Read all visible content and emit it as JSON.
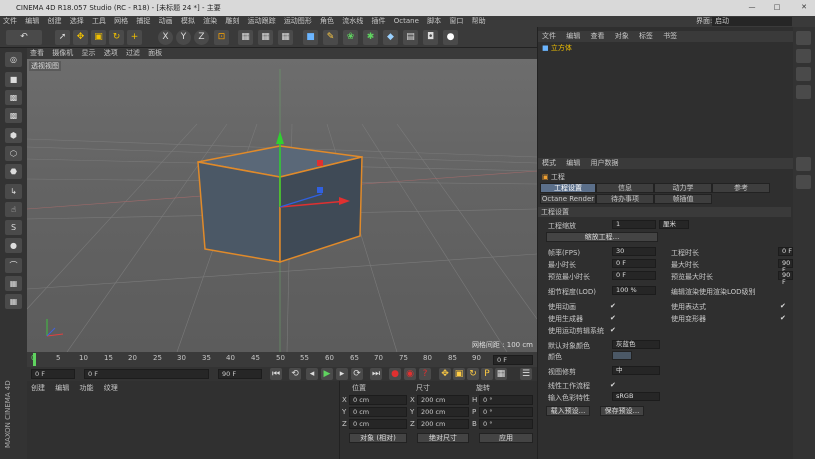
{
  "window": {
    "title": "CINEMA 4D R18.057 Studio (RC - R18) - [未标题 24 *] - 主要"
  },
  "menu": [
    "文件",
    "编辑",
    "创建",
    "选择",
    "工具",
    "网格",
    "捕捉",
    "动画",
    "模拟",
    "渲染",
    "雕刻",
    "运动跟踪",
    "运动图形",
    "角色",
    "流水线",
    "插件",
    "Octane",
    "脚本",
    "窗口",
    "帮助"
  ],
  "layout": {
    "label": "界面:",
    "value": "启动"
  },
  "toolbar": {
    "x": "X",
    "y": "Y",
    "z": "Z"
  },
  "viewport": {
    "menu": [
      "查看",
      "摄像机",
      "显示",
      "选项",
      "过滤",
      "面板"
    ],
    "tag": "透视视图",
    "grid": "网格间距 : 100 cm"
  },
  "timeline": {
    "ticks": [
      "0",
      "5",
      "10",
      "15",
      "20",
      "25",
      "30",
      "35",
      "40",
      "45",
      "50",
      "55",
      "60",
      "65",
      "70",
      "75",
      "80",
      "85",
      "90"
    ],
    "frame": "0 F"
  },
  "transport": {
    "start": "0 F",
    "cur": "0 F",
    "end": "90 F",
    "end2": "90 F"
  },
  "materials": {
    "menu": [
      "创建",
      "编辑",
      "功能",
      "纹理"
    ]
  },
  "coords": {
    "headers": [
      "位置",
      "尺寸",
      "旋转"
    ],
    "rows": [
      {
        "axis": "X",
        "pos": "0 cm",
        "sizeAxis": "X",
        "size": "200 cm",
        "rotAxis": "H",
        "rot": "0 °"
      },
      {
        "axis": "Y",
        "pos": "0 cm",
        "sizeAxis": "Y",
        "size": "200 cm",
        "rotAxis": "P",
        "rot": "0 °"
      },
      {
        "axis": "Z",
        "pos": "0 cm",
        "sizeAxis": "Z",
        "size": "200 cm",
        "rotAxis": "B",
        "rot": "0 °"
      }
    ],
    "mode": "对象 (相对)",
    "sizeMode": "绝对尺寸",
    "apply": "应用"
  },
  "objects": {
    "menu": [
      "文件",
      "编辑",
      "查看",
      "对象",
      "标签",
      "书签"
    ],
    "item": "立方体"
  },
  "attributes": {
    "menu": [
      "模式",
      "编辑",
      "用户数据"
    ],
    "title": "工程",
    "tabs": [
      "工程设置",
      "信息",
      "动力学",
      "参考"
    ],
    "tabs2": [
      "Octane Render",
      "待办事项",
      "帧插值"
    ],
    "section": "工程设置",
    "scaleLabel": "工程缩放",
    "scaleVal": "1",
    "scaleUnit": "厘米",
    "scaleBtn": "缩放工程...",
    "fpsLabel": "帧率(FPS)",
    "fps": "30",
    "projLenLabel": "工程时长",
    "projLen": "0 F",
    "minLabel": "最小时长",
    "min": "0 F",
    "maxLabel": "最大时长",
    "max": "90 F",
    "pminLabel": "预览最小时长",
    "pmin": "0 F",
    "pmaxLabel": "预览最大时长",
    "pmax": "90 F",
    "lodLabel": "细节程度(LOD)",
    "lod": "100 %",
    "lodEdit": "编辑渲染使用渲染LOD级别",
    "checks": [
      "使用动画",
      "使用表达式",
      "使用生成器",
      "使用变形器",
      "使用运动剪辑系统"
    ],
    "defColorLabel": "默认对象颜色",
    "defColor": "灰蓝色",
    "colorLabel": "颜色",
    "viewLabel": "视图修剪",
    "view": "中",
    "linearLabel": "线性工作流程",
    "inputLabel": "输入色彩特性",
    "input": "sRGB",
    "loadBtn": "载入预设...",
    "saveBtn": "保存预设..."
  },
  "brand": "MAXON CINEMA 4D",
  "colors": {
    "accent": "#5b6f8a",
    "cube": "#4b5866",
    "edge": "#e08a2a"
  }
}
